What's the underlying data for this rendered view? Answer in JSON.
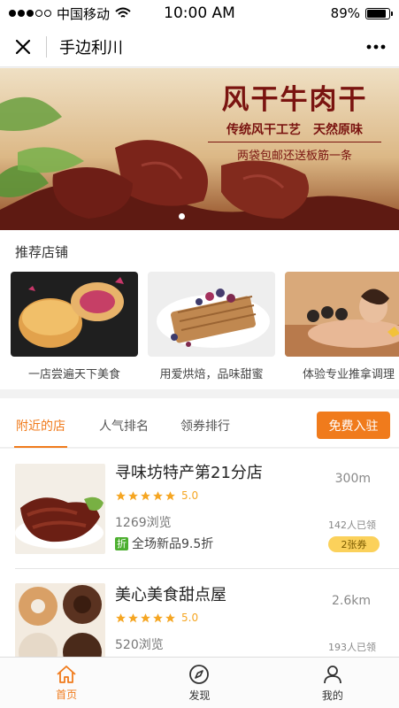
{
  "status_bar": {
    "carrier": "中国移动",
    "time": "10:00 AM",
    "battery": "89%",
    "battery_level": 0.89
  },
  "nav": {
    "title": "手边利川",
    "close_icon": "close-icon",
    "more_icon": "more-icon"
  },
  "banner": {
    "title": "风干牛肉干",
    "subtitle": "传统风干工艺　天然原味",
    "note": "两袋包邮还送板筋一条",
    "active_slide": 1,
    "slide_count": 1
  },
  "recommend": {
    "title": "推荐店铺",
    "items": [
      {
        "label": "一店尝遍天下美食"
      },
      {
        "label": "用爱烘焙，品味甜蜜"
      },
      {
        "label": "体验专业推拿调理"
      }
    ]
  },
  "tabs": {
    "items": [
      {
        "label": "附近的店",
        "active": true
      },
      {
        "label": "人气排名",
        "active": false
      },
      {
        "label": "领券排行",
        "active": false
      }
    ],
    "join_button": "免费入驻"
  },
  "stores": [
    {
      "name": "寻味坊特产第21分店",
      "rating": "5.0",
      "stars": 5,
      "views": "1269浏览",
      "promo_tag": "折",
      "promo": "全场新品9.5折",
      "distance": "300m",
      "claimed": "142人已领",
      "coupon": "2张券"
    },
    {
      "name": "美心美食甜点屋",
      "rating": "5.0",
      "stars": 5,
      "views": "520浏览",
      "distance": "2.6km",
      "claimed": "193人已领"
    }
  ],
  "tabbar": {
    "items": [
      {
        "label": "首页",
        "icon": "home-icon",
        "active": true
      },
      {
        "label": "发现",
        "icon": "compass-icon",
        "active": false
      },
      {
        "label": "我的",
        "icon": "user-icon",
        "active": false
      }
    ]
  },
  "colors": {
    "accent": "#f07b1c",
    "star": "#f5a623",
    "promo_green": "#4caf2f",
    "coupon_yellow": "#fbd15b"
  }
}
